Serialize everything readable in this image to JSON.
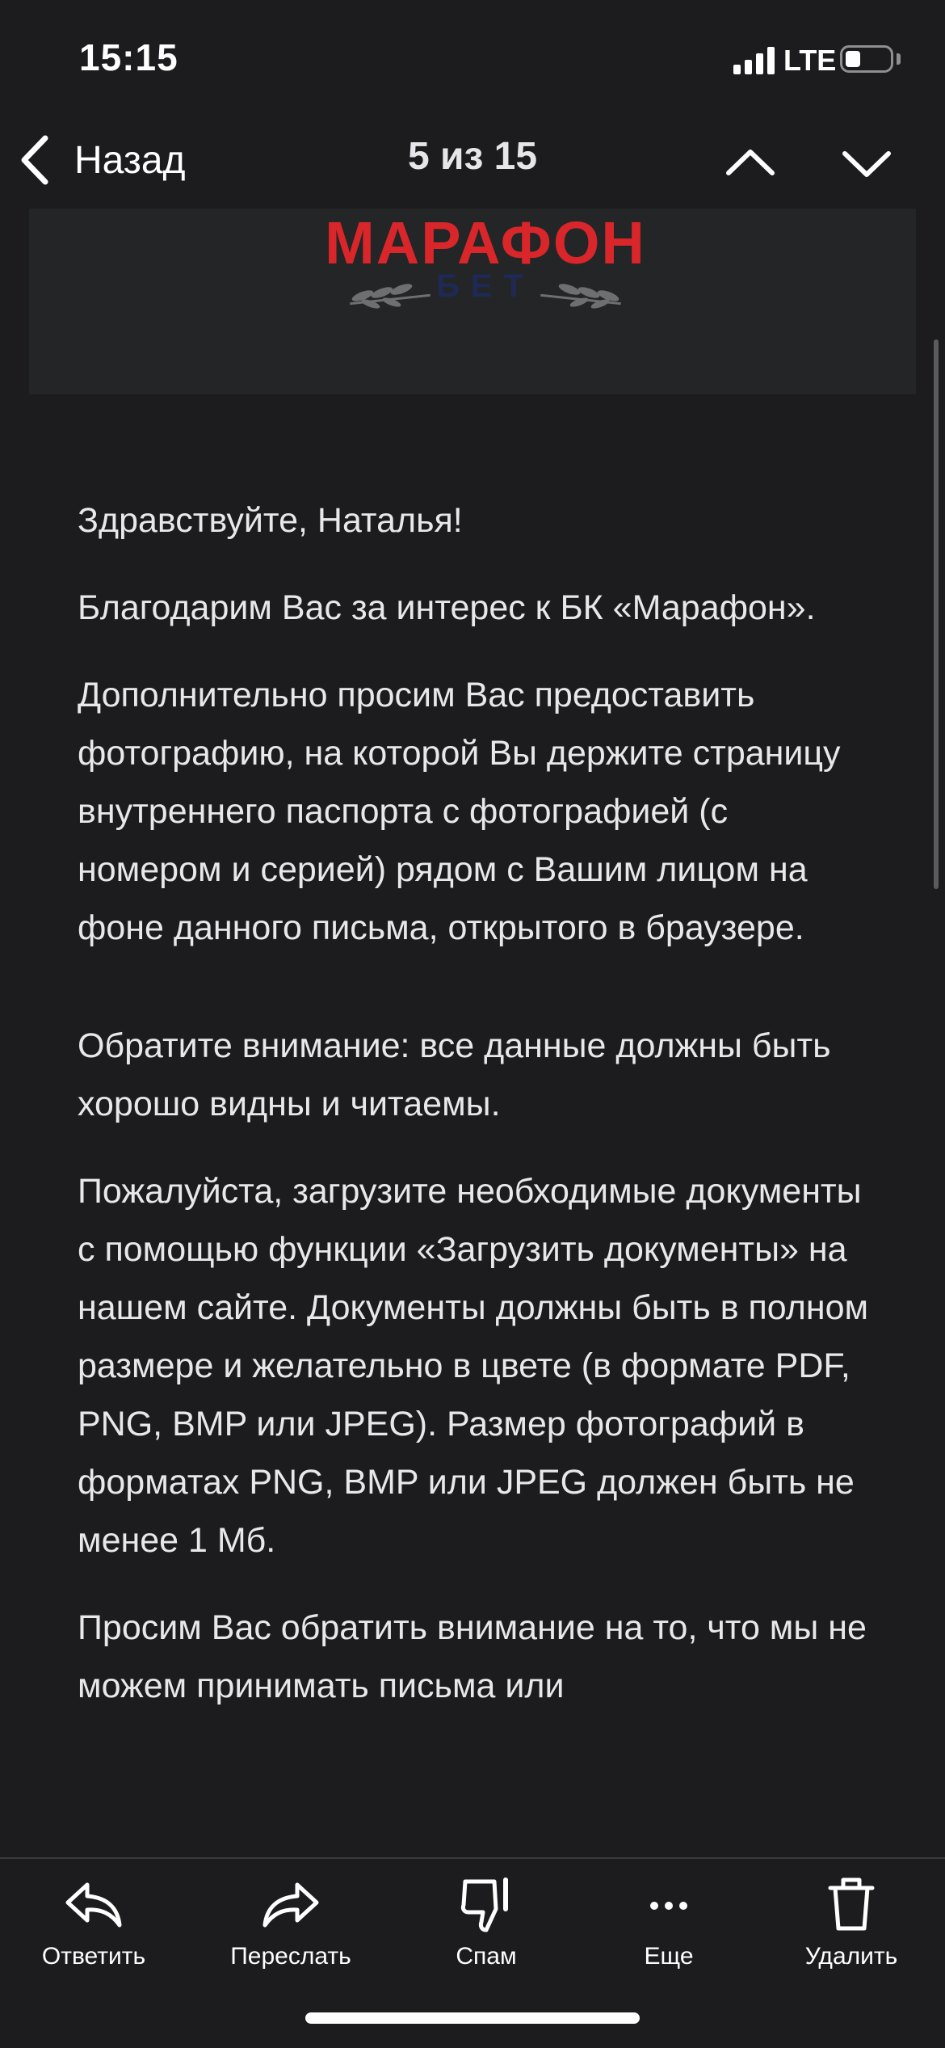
{
  "status_bar": {
    "time": "15:15",
    "network": "LTE"
  },
  "nav": {
    "back_label": "Назад",
    "title": "5 из 15"
  },
  "banner": {
    "logo_text": "МАРАФОН",
    "logo_sub": "БЕТ"
  },
  "email": {
    "greeting": "Здравствуйте, Наталья!",
    "p1": "Благодарим Вас за интерес к БК «Марафон».",
    "p2": "Дополнительно просим Вас предоставить фотографию, на которой Вы держите страницу внутреннего паспорта с фотографией (с номером и серией) рядом с Вашим лицом на фоне данного письма, открытого в браузере.",
    "p3": "Обратите внимание: все данные должны быть хорошо видны и читаемы.",
    "p4": "Пожалуйста, загрузите необходимые документы с помощью функции «Загрузить документы» на нашем сайте. Документы должны быть в полном размере и желательно в цвете (в формате PDF, PNG, BMP или JPEG). Размер фотографий в форматах PNG, BMP или JPEG должен быть не менее 1 Мб.",
    "p5": "Просим Вас обратить внимание на то, что мы не можем принимать письма или"
  },
  "toolbar": {
    "reply": "Ответить",
    "forward": "Переслать",
    "spam": "Спам",
    "more": "Еще",
    "delete": "Удалить"
  },
  "colors": {
    "background": "#1c1c1e",
    "logo_red": "#d8262a",
    "logo_blue": "#1e2a55"
  }
}
